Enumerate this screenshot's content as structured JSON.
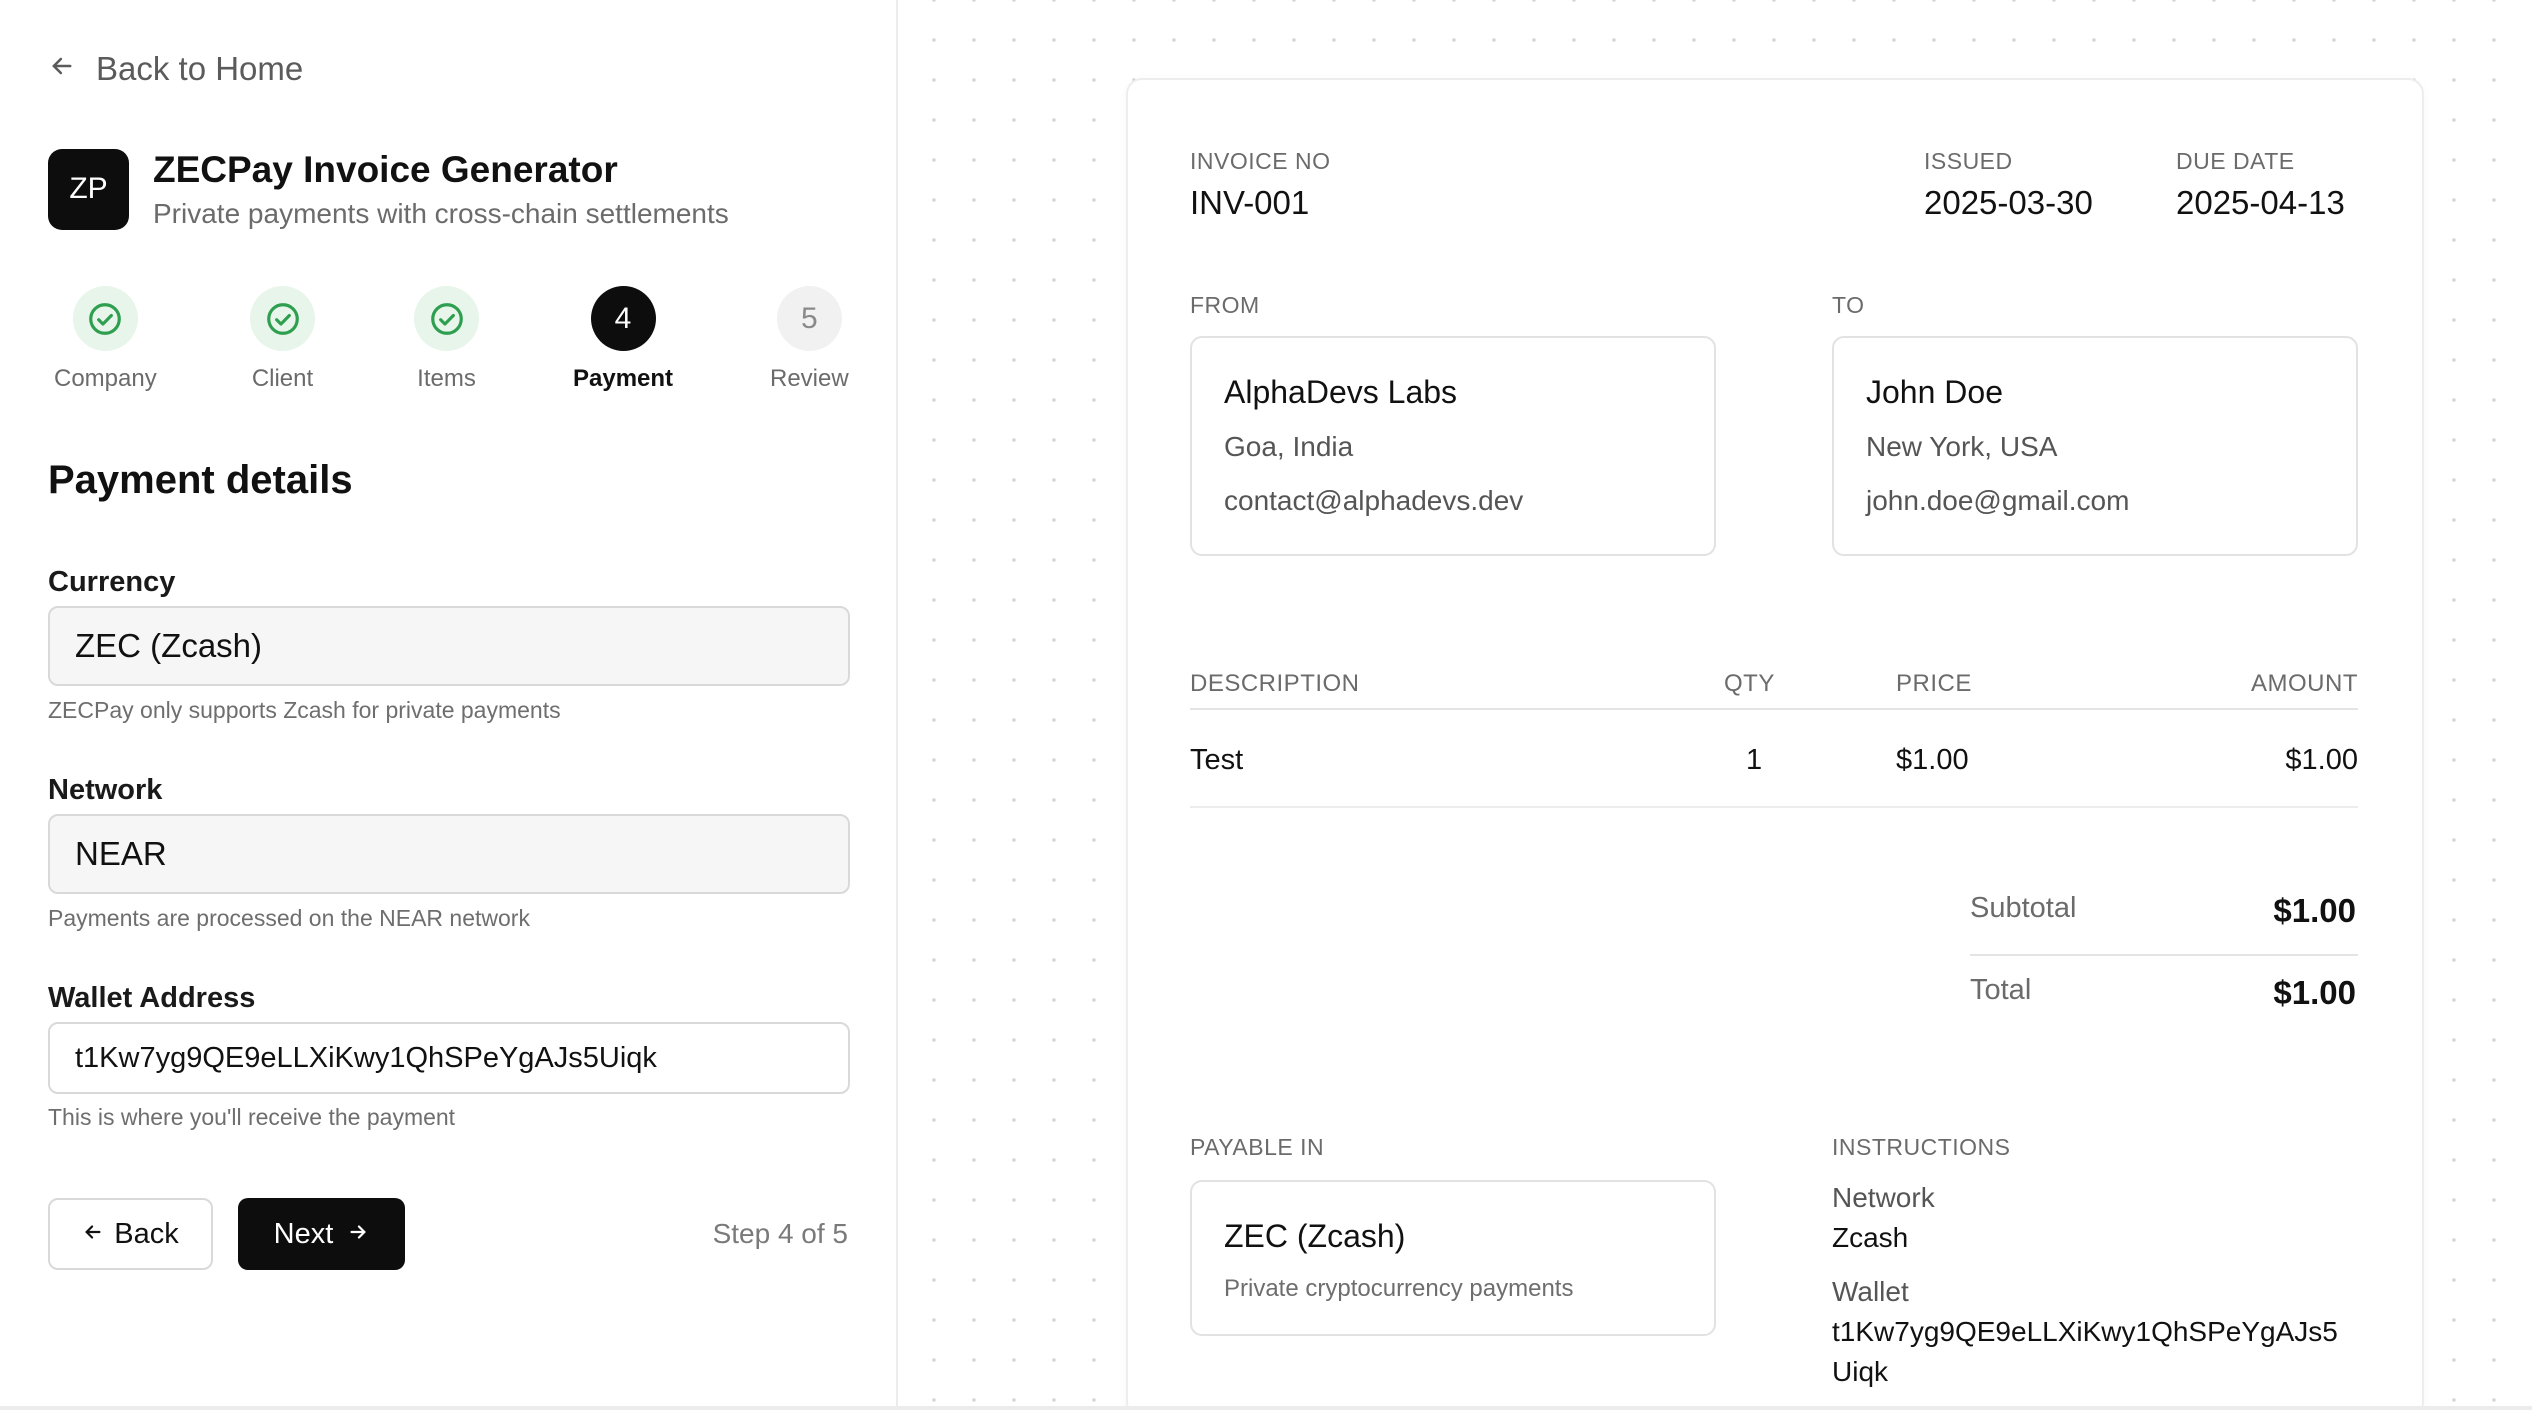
{
  "nav": {
    "back_home": "Back to Home"
  },
  "brand": {
    "logo": "ZP",
    "title": "ZECPay Invoice Generator",
    "subtitle": "Private payments with cross-chain settlements"
  },
  "steps": [
    {
      "label": "Company",
      "state": "done",
      "number": "1"
    },
    {
      "label": "Client",
      "state": "done",
      "number": "2"
    },
    {
      "label": "Items",
      "state": "done",
      "number": "3"
    },
    {
      "label": "Payment",
      "state": "active",
      "number": "4"
    },
    {
      "label": "Review",
      "state": "pending",
      "number": "5"
    }
  ],
  "form": {
    "title": "Payment details",
    "currency": {
      "label": "Currency",
      "value": "ZEC (Zcash)",
      "help": "ZECPay only supports Zcash for private payments"
    },
    "network": {
      "label": "Network",
      "value": "NEAR",
      "help": "Payments are processed on the NEAR network"
    },
    "wallet": {
      "label": "Wallet Address",
      "value": "t1Kw7yg9QE9eLLXiKwy1QhSPeYgAJs5Uiqk",
      "help": "This is where you'll receive the payment"
    },
    "back_label": "Back",
    "next_label": "Next",
    "step_count": "Step 4 of 5"
  },
  "invoice": {
    "invoice_no_label": "INVOICE NO",
    "invoice_no": "INV-001",
    "issued_label": "ISSUED",
    "issued": "2025-03-30",
    "due_label": "DUE DATE",
    "due": "2025-04-13",
    "from_label": "FROM",
    "from": {
      "name": "AlphaDevs Labs",
      "location": "Goa, India",
      "email": "contact@alphadevs.dev"
    },
    "to_label": "TO",
    "to": {
      "name": "John Doe",
      "location": "New York, USA",
      "email": "john.doe@gmail.com"
    },
    "table": {
      "headers": {
        "description": "DESCRIPTION",
        "qty": "QTY",
        "price": "PRICE",
        "amount": "AMOUNT"
      },
      "rows": [
        {
          "description": "Test",
          "qty": "1",
          "price": "$1.00",
          "amount": "$1.00"
        }
      ]
    },
    "subtotal_label": "Subtotal",
    "subtotal": "$1.00",
    "total_label": "Total",
    "total": "$1.00",
    "payable_label": "PAYABLE IN",
    "payable_name": "ZEC (Zcash)",
    "payable_sub": "Private cryptocurrency payments",
    "instructions_label": "INSTRUCTIONS",
    "network_label": "Network",
    "network_value": "Zcash",
    "wallet_label": "Wallet",
    "wallet_line1": "t1Kw7yg9QE9eLLXiKwy1QhSPeYgAJs5",
    "wallet_line2": "Uiqk"
  },
  "colors": {
    "accent": "#0d0d0d",
    "done_green": "#2e9e4f",
    "done_bg": "#e7f5ea"
  }
}
